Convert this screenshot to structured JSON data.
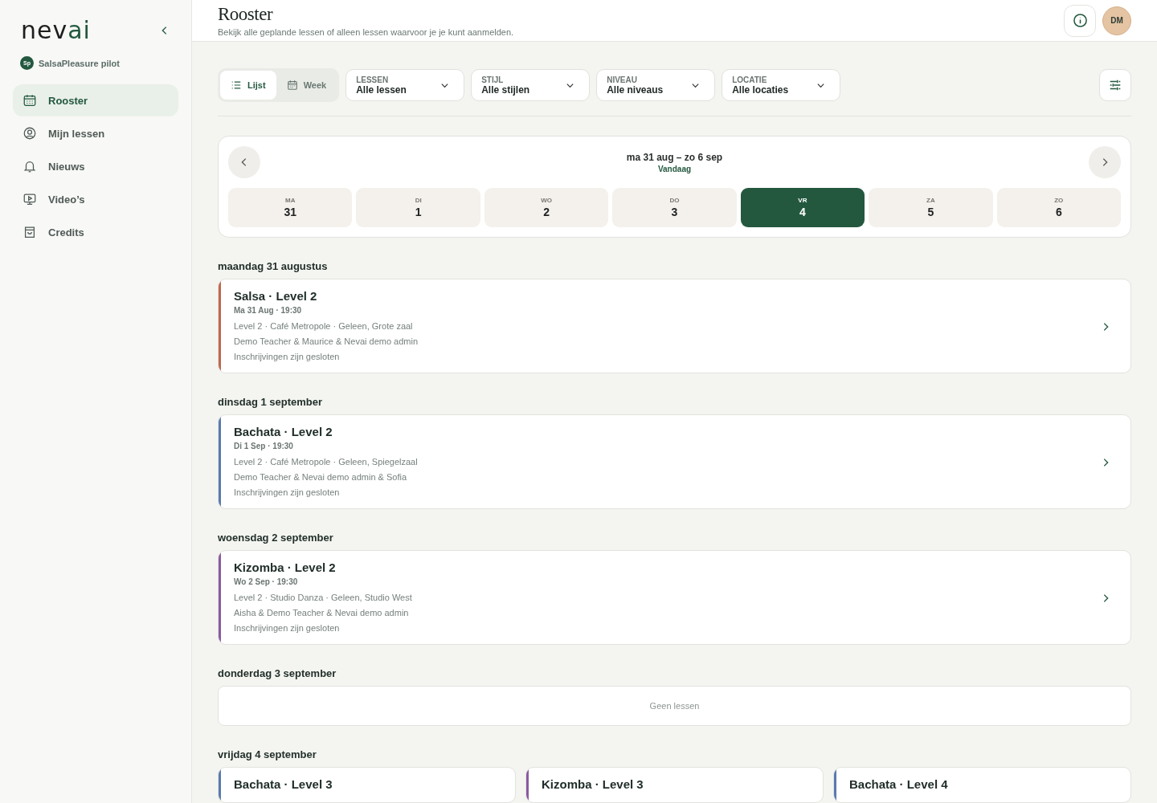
{
  "sidebar": {
    "logo": {
      "dark": "nev",
      "accent": "ai"
    },
    "org": {
      "initials": "Sp",
      "name": "SalsaPleasure pilot"
    },
    "items": [
      {
        "label": "Rooster",
        "selected": true
      },
      {
        "label": "Mijn lessen",
        "selected": false
      },
      {
        "label": "Nieuws",
        "selected": false
      },
      {
        "label": "Video’s",
        "selected": false
      },
      {
        "label": "Credits",
        "selected": false
      }
    ]
  },
  "header": {
    "title": "Rooster",
    "subtitle": "Bekijk alle geplande lessen of alleen lessen waarvoor je je kunt aanmelden.",
    "avatar": "DM"
  },
  "view_toggle": [
    {
      "label": "Lijst",
      "selected": true
    },
    {
      "label": "Week",
      "selected": false
    }
  ],
  "filters": [
    {
      "label": "LESSEN",
      "value": "Alle lessen"
    },
    {
      "label": "STIJL",
      "value": "Alle stijlen"
    },
    {
      "label": "NIVEAU",
      "value": "Alle niveaus"
    },
    {
      "label": "LOCATIE",
      "value": "Alle locaties"
    }
  ],
  "week": {
    "range": "ma 31 aug – zo 6 sep",
    "today_link": "Vandaag",
    "days": [
      {
        "weekday": "MA",
        "date": "31",
        "selected": false
      },
      {
        "weekday": "DI",
        "date": "1",
        "selected": false
      },
      {
        "weekday": "WO",
        "date": "2",
        "selected": false
      },
      {
        "weekday": "DO",
        "date": "3",
        "selected": false
      },
      {
        "weekday": "VR",
        "date": "4",
        "selected": true
      },
      {
        "weekday": "ZA",
        "date": "5",
        "selected": false
      },
      {
        "weekday": "ZO",
        "date": "6",
        "selected": false
      }
    ]
  },
  "schedule": [
    {
      "heading": "maandag 31 augustus",
      "lessons": [
        {
          "title": "Salsa · Level 2",
          "when": "Ma 31 Aug · 19:30",
          "color": "#c0664f",
          "details": [
            "Level 2 · Café Metropole · Geleen, Grote zaal",
            "Demo Teacher & Maurice & Nevai demo admin",
            "Inschrijvingen zijn gesloten"
          ]
        }
      ]
    },
    {
      "heading": "dinsdag 1 september",
      "lessons": [
        {
          "title": "Bachata · Level 2",
          "when": "Di 1 Sep · 19:30",
          "color": "#5b79b0",
          "details": [
            "Level 2 · Café Metropole · Geleen, Spiegelzaal",
            "Demo Teacher & Nevai demo admin & Sofia",
            "Inschrijvingen zijn gesloten"
          ]
        }
      ]
    },
    {
      "heading": "woensdag 2 september",
      "lessons": [
        {
          "title": "Kizomba · Level 2",
          "when": "Wo 2 Sep · 19:30",
          "color": "#8a5aa0",
          "details": [
            "Level 2 · Studio Danza · Geleen, Studio West",
            "Aisha & Demo Teacher & Nevai demo admin",
            "Inschrijvingen zijn gesloten"
          ]
        }
      ]
    },
    {
      "heading": "donderdag 3 september",
      "empty": "Geen lessen"
    },
    {
      "heading": "vrijdag 4 september",
      "lessons": [
        {
          "title": "Bachata · Level 3",
          "color": "#5b79b0"
        },
        {
          "title": "Kizomba · Level 3",
          "color": "#8a5aa0"
        },
        {
          "title": "Bachata · Level 4",
          "color": "#5b79b0"
        }
      ]
    }
  ]
}
